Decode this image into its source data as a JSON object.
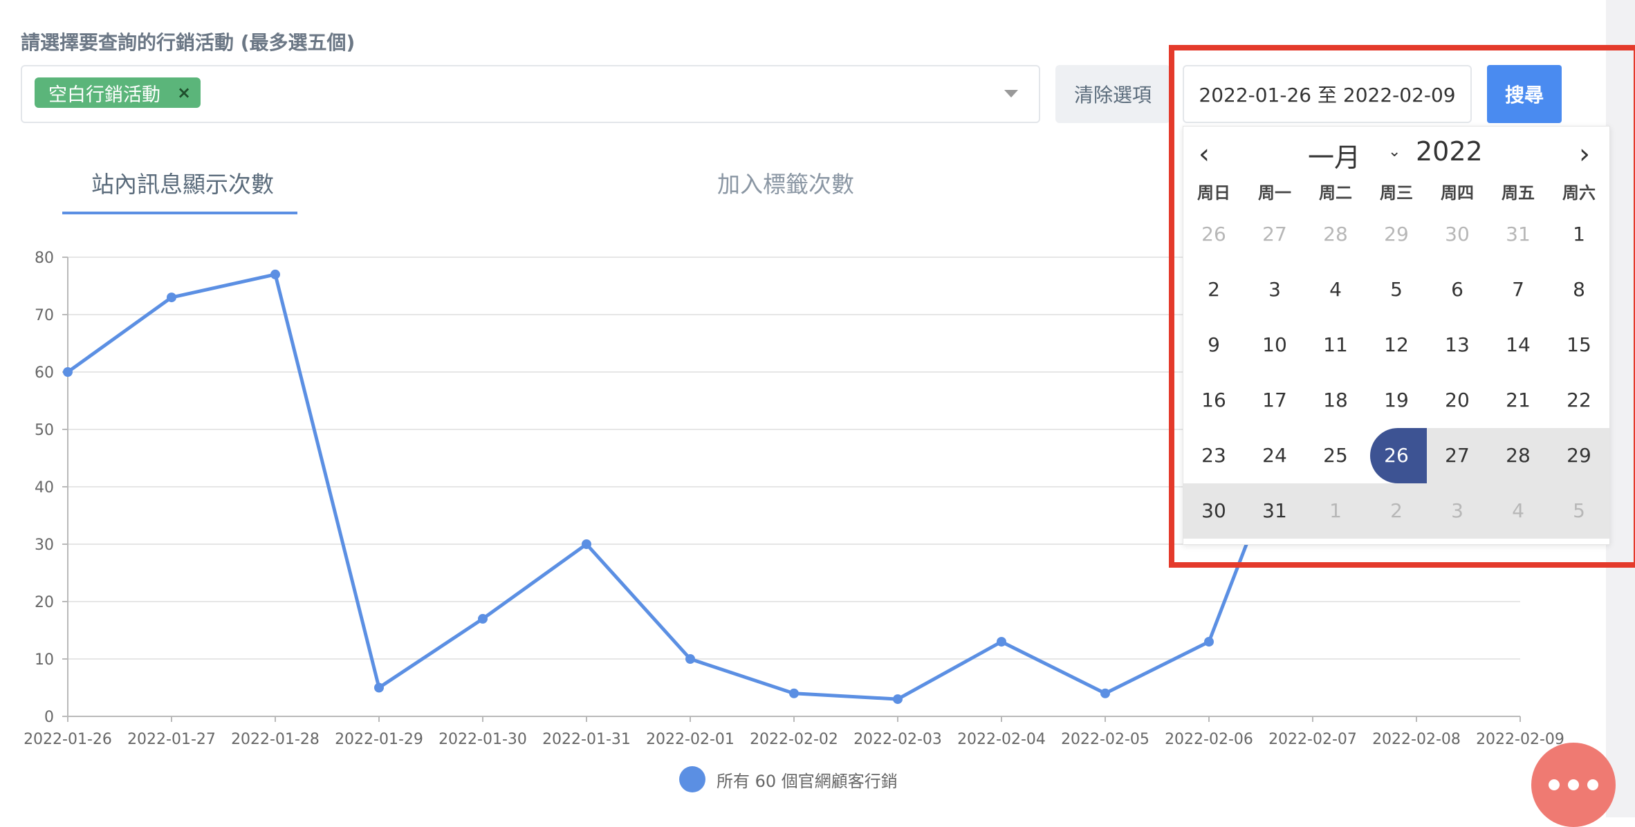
{
  "filter": {
    "label": "請選擇要查詢的行銷活動 (最多選五個)",
    "selected_tag": "空白行銷活動",
    "tag_remove": "×",
    "clear_button": "清除選項",
    "date_range": "2022-01-26 至 2022-02-09",
    "search_button": "搜尋"
  },
  "tabs": [
    {
      "label": "站內訊息顯示次數",
      "active": true
    },
    {
      "label": "加入標籤次數",
      "active": false
    }
  ],
  "calendar": {
    "prev": "‹",
    "next": "›",
    "month": "一月",
    "year": "2022",
    "weekdays": [
      "周日",
      "周一",
      "周二",
      "周三",
      "周四",
      "周五",
      "周六"
    ],
    "weeks": [
      [
        "26",
        "27",
        "28",
        "29",
        "30",
        "31",
        "1"
      ],
      [
        "2",
        "3",
        "4",
        "5",
        "6",
        "7",
        "8"
      ],
      [
        "9",
        "10",
        "11",
        "12",
        "13",
        "14",
        "15"
      ],
      [
        "16",
        "17",
        "18",
        "19",
        "20",
        "21",
        "22"
      ],
      [
        "23",
        "24",
        "25",
        "26",
        "27",
        "28",
        "29"
      ],
      [
        "30",
        "31",
        "1",
        "2",
        "3",
        "4",
        "5"
      ]
    ],
    "selected_date": "26"
  },
  "chart_data": {
    "type": "line",
    "categories": [
      "2022-01-26",
      "2022-01-27",
      "2022-01-28",
      "2022-01-29",
      "2022-01-30",
      "2022-01-31",
      "2022-02-01",
      "2022-02-02",
      "2022-02-03",
      "2022-02-04",
      "2022-02-05",
      "2022-02-06",
      "2022-02-07",
      "2022-02-08",
      "2022-02-09"
    ],
    "series": [
      {
        "name": "所有 60 個官網顧客行銷",
        "values": [
          60,
          73,
          77,
          5,
          17,
          30,
          10,
          4,
          3,
          13,
          4,
          13,
          60,
          null,
          null
        ],
        "color": "#5b8fe3"
      }
    ],
    "ylim": [
      0,
      80
    ],
    "yticks": [
      "0",
      "10",
      "20",
      "30",
      "40",
      "50",
      "60",
      "70",
      "80"
    ],
    "grid": true,
    "legend": "bottom-center"
  },
  "colors": {
    "accent": "#4a8bf0",
    "series": "#5b8fe3",
    "tag": "#5bb57a",
    "highlight_frame": "#e43a2b",
    "selected_day": "#3d5393"
  },
  "chat_button_icon": "more-dots-icon"
}
